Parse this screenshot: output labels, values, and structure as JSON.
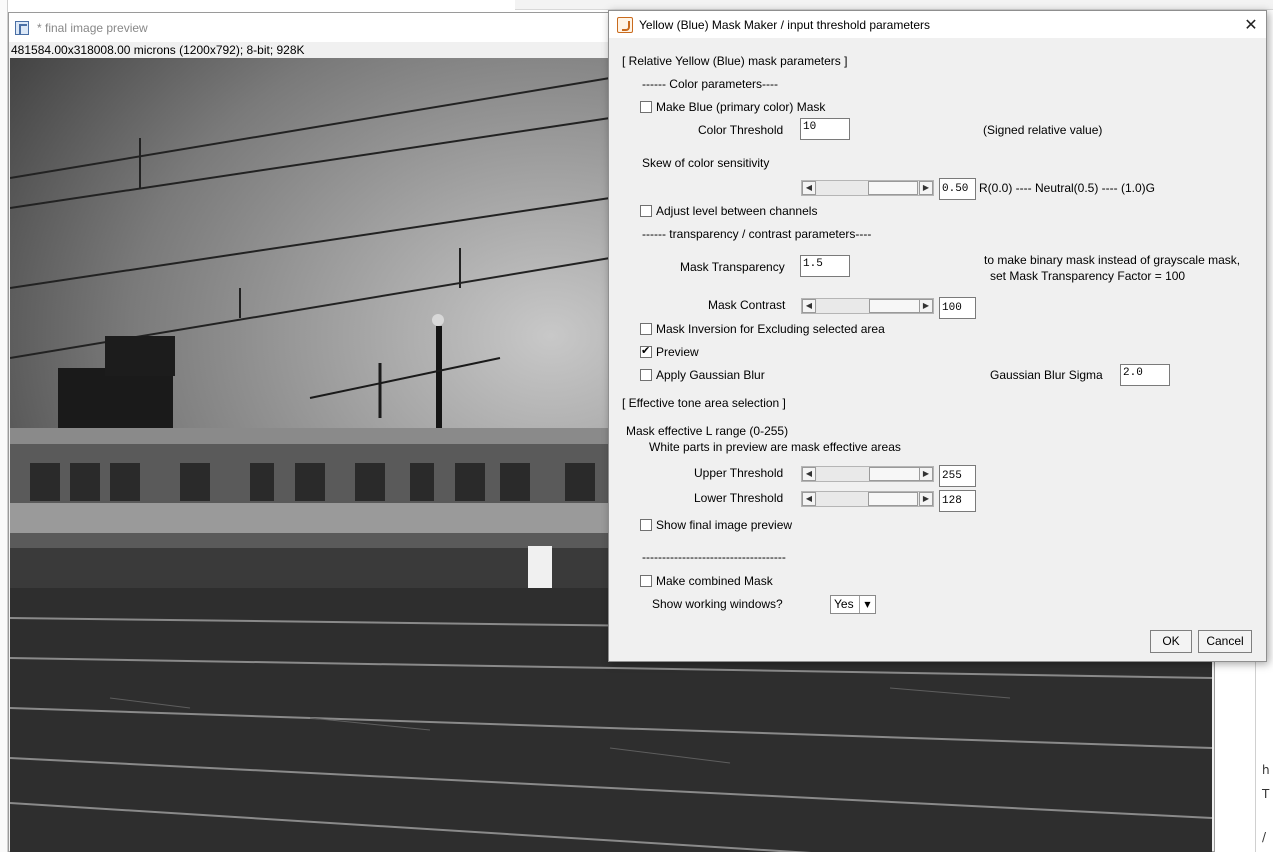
{
  "image_window": {
    "title": "* final image preview",
    "info": "481584.00x318008.00 microns (1200x792); 8-bit; 928K"
  },
  "dialog": {
    "title": "Yellow (Blue) Mask Maker / input threshold parameters",
    "close_glyph": "✕",
    "section_relative": "[ Relative Yellow (Blue) mask parameters ]",
    "color_params_heading": "------ Color parameters----",
    "make_blue_label": "Make Blue (primary color) Mask",
    "make_blue_checked": false,
    "color_threshold_label": "Color Threshold",
    "color_threshold_value": "10",
    "color_threshold_hint": "(Signed relative value)",
    "skew_label": "Skew of color sensitivity",
    "skew_value": "0.50",
    "skew_position": 0.5,
    "skew_hint": "R(0.0) ---- Neutral(0.5) ---- (1.0)G",
    "adjust_level_label": "Adjust level between channels",
    "adjust_level_checked": false,
    "transparency_heading": "------ transparency / contrast parameters----",
    "mask_transparency_label": "Mask Transparency",
    "mask_transparency_value": "1.5",
    "binary_hint_1": "to make binary mask instead of grayscale mask,",
    "binary_hint_2": "set Mask Transparency Factor = 100",
    "mask_contrast_label": "Mask Contrast",
    "mask_contrast_value": "100",
    "mask_contrast_position": 1.0,
    "mask_inversion_label": "Mask Inversion for Excluding selected area",
    "mask_inversion_checked": false,
    "preview_label": "Preview",
    "preview_checked": true,
    "gaussian_blur_label": "Apply Gaussian Blur",
    "gaussian_blur_checked": false,
    "gaussian_sigma_label": "Gaussian Blur Sigma",
    "gaussian_sigma_value": "2.0",
    "section_tone": "[ Effective tone area selection ]",
    "l_range_label": "Mask effective L range (0-255)",
    "white_parts_note": "White parts in preview are mask effective areas",
    "upper_threshold_label": "Upper Threshold",
    "upper_threshold_value": "255",
    "upper_threshold_position": 1.0,
    "lower_threshold_label": "Lower Threshold",
    "lower_threshold_value": "128",
    "lower_threshold_position": 0.5,
    "show_final_label": "Show final image preview",
    "show_final_checked": false,
    "separator_line": "------------------------------------",
    "combined_mask_label": "Make combined Mask",
    "combined_mask_checked": false,
    "show_working_label": "Show working windows?",
    "show_working_value": "Yes",
    "ok_label": "OK",
    "cancel_label": "Cancel"
  },
  "background": {
    "right_glyphs": [
      "h",
      "T",
      "/"
    ]
  }
}
